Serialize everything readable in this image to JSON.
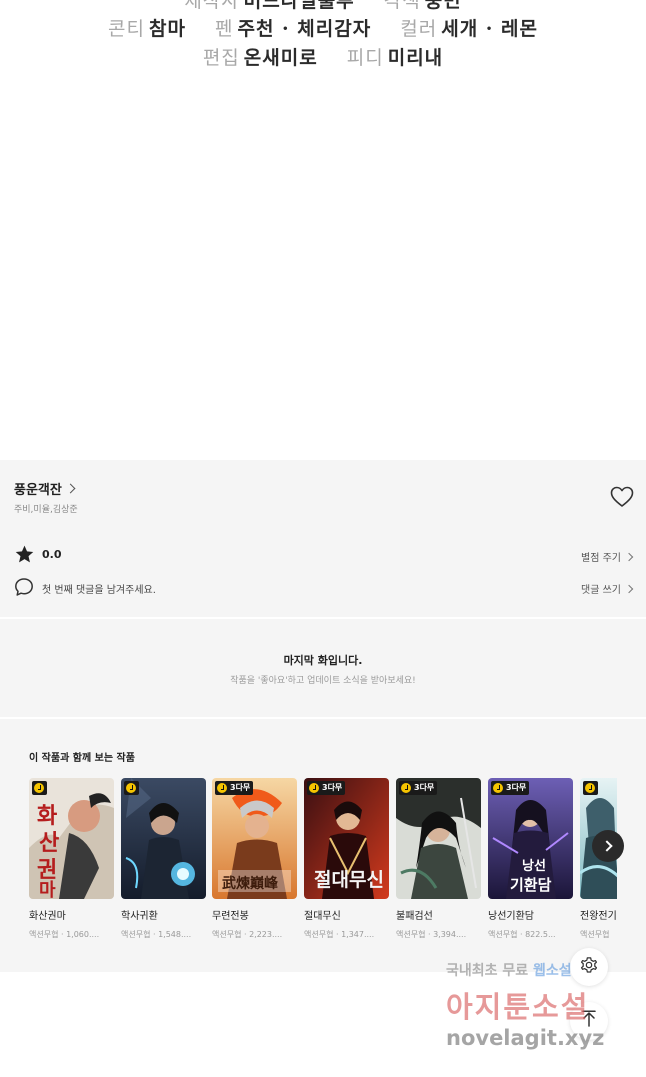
{
  "credits": {
    "line0": [
      {
        "role": "제작사",
        "name": "머드나일룰루"
      },
      {
        "role": "각색",
        "name": "중민"
      }
    ],
    "line1": [
      {
        "role": "콘티",
        "name": "참마"
      },
      {
        "role": "펜",
        "name": "주천 · 체리감자"
      },
      {
        "role": "컬러",
        "name": "세개 · 레몬"
      }
    ],
    "line2": [
      {
        "role": "편집",
        "name": "온새미로"
      },
      {
        "role": "피디",
        "name": "미리내"
      }
    ]
  },
  "series": {
    "title": "풍운객잔",
    "authors": "주비,미율,김상준",
    "heart_icon": "heart-outline-icon"
  },
  "rating": {
    "value": "0.0",
    "star_icon": "star-icon",
    "rate_label": "별점 주기"
  },
  "comments": {
    "prompt": "첫 번째 댓글을 남겨주세요.",
    "write_label": "댓글 쓰기",
    "icon": "comment-bubble-icon"
  },
  "last_episode": {
    "title": "마지막 화입니다.",
    "subtitle": "작품을 '좋아요'하고 업데이트 소식을 받아보세요!"
  },
  "recommendations": {
    "heading": "이 작품과 함께 보는 작품",
    "items": [
      {
        "title": "화산권마",
        "meta": "액션무협 · 1,060....",
        "badge": "",
        "cover_icon": "cover-art-hwasan"
      },
      {
        "title": "학사귀환",
        "meta": "액션무협 · 1,548....",
        "badge": "",
        "cover_icon": "cover-art-haksa"
      },
      {
        "title": "무련전봉",
        "meta": "액션무협 · 2,223....",
        "badge": "3다무",
        "cover_icon": "cover-art-muryeon"
      },
      {
        "title": "절대무신",
        "meta": "액션무협 · 1,347....",
        "badge": "3다무",
        "cover_icon": "cover-art-jeoldae"
      },
      {
        "title": "불패검선",
        "meta": "액션무협 · 3,394....",
        "badge": "3다무",
        "cover_icon": "cover-art-bulpae"
      },
      {
        "title": "낭선기환담",
        "meta": "액션무협 · 822.5...",
        "badge": "3다무",
        "cover_icon": "cover-art-nangseon"
      },
      {
        "title": "전왕전기",
        "meta": "액션무협",
        "badge": "",
        "cover_icon": "cover-art-jeonwang"
      }
    ],
    "next_icon": "chevron-right-icon"
  },
  "floating": {
    "settings_icon": "gear-icon",
    "top_icon": "arrow-up-icon"
  },
  "watermark": {
    "line1_a": "국내최초 무료",
    "line1_b": "웹소설",
    "line2": "아지툰소설",
    "line3": "novelagit.xyz"
  }
}
